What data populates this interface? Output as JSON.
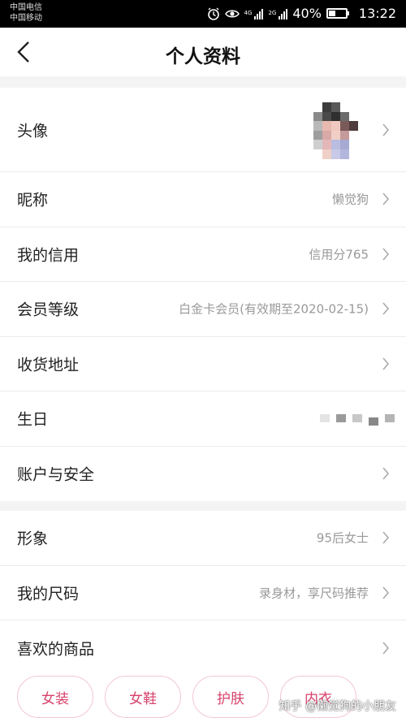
{
  "status_bar": {
    "carrier_1": "中国电信",
    "carrier_2": "中国移动",
    "network_1": "4G",
    "network_2": "2G",
    "battery": "40%",
    "time": "13:22"
  },
  "nav": {
    "title": "个人资料"
  },
  "profile_section": [
    {
      "label": "头像",
      "value": ""
    },
    {
      "label": "昵称",
      "value": "懒觉狗"
    },
    {
      "label": "我的信用",
      "value": "信用分765"
    },
    {
      "label": "会员等级",
      "value": "白金卡会员(有效期至2020-02-15)"
    },
    {
      "label": "收货地址",
      "value": ""
    },
    {
      "label": "生日",
      "value": ""
    },
    {
      "label": "账户与安全",
      "value": ""
    }
  ],
  "style_section": [
    {
      "label": "形象",
      "value": "95后女士"
    },
    {
      "label": "我的尺码",
      "value": "录身材，享尺码推荐"
    },
    {
      "label": "喜欢的商品",
      "value": ""
    }
  ],
  "tags": [
    "女装",
    "女鞋",
    "护肤",
    "内衣"
  ],
  "watermark": "知乎 @懒觉狗的小朋友",
  "colors": {
    "tag_text": "#d7426c",
    "tag_border": "#f3c7d4",
    "background": "#f4f4f4"
  }
}
